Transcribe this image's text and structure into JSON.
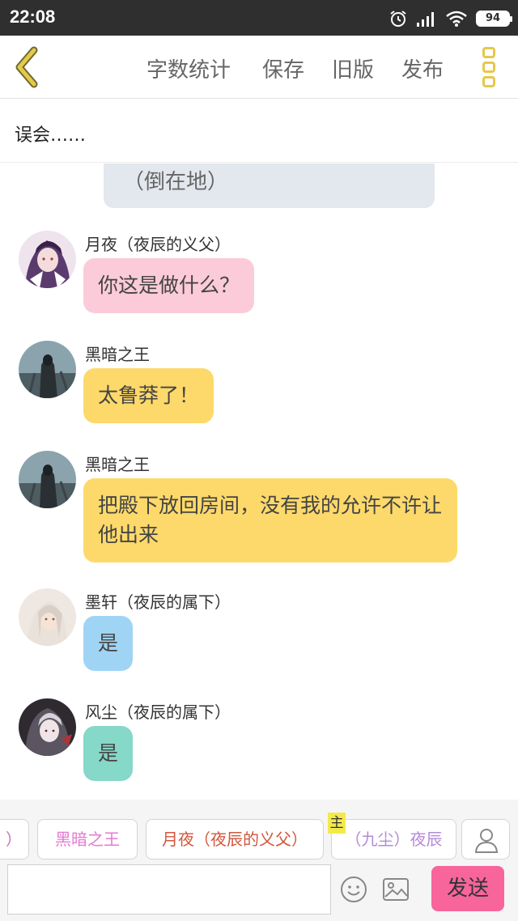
{
  "status_bar": {
    "time": "22:08",
    "battery": "94",
    "icons": [
      "alarm-icon",
      "signal-icon",
      "wifi-icon",
      "battery-icon"
    ]
  },
  "toolbar": {
    "back_icon": "chevron-left-icon",
    "word_count": "字数统计",
    "save": "保存",
    "old_version": "旧版",
    "publish": "发布",
    "menu_icon": "more-vertical-icon"
  },
  "chapter": {
    "title": "误会……"
  },
  "messages": [
    {
      "type": "narration",
      "text": "（倒在地）"
    },
    {
      "type": "chat",
      "sender": "月夜（夜辰的义父）",
      "text": "你这是做什么？",
      "bubble_color": "#fccbd9"
    },
    {
      "type": "chat",
      "sender": "黑暗之王",
      "text": "太鲁莽了！",
      "bubble_color": "#fcd96a"
    },
    {
      "type": "chat",
      "sender": "黑暗之王",
      "text": "把殿下放回房间，没有我的允许不许让他出来",
      "bubble_color": "#fcd96a"
    },
    {
      "type": "chat",
      "sender": "墨轩（夜辰的属下）",
      "text": "是",
      "bubble_color": "#9fd4f5"
    },
    {
      "type": "chat",
      "sender": "风尘（夜辰的属下）",
      "text": "是",
      "bubble_color": "#86d8c9"
    }
  ],
  "character_bar": {
    "chips": [
      {
        "label": "）",
        "color": "#d06bc0"
      },
      {
        "label": "黑暗之王",
        "color": "#e47ad0"
      },
      {
        "label": "月夜（夜辰的义父）",
        "color": "#d2573e"
      },
      {
        "label": "（九尘）夜辰",
        "color": "#b58ad8"
      }
    ],
    "host_badge": "主",
    "person_icon": "person-icon"
  },
  "input_bar": {
    "value": "",
    "placeholder": "",
    "emoji_icon": "smiley-icon",
    "image_icon": "image-icon",
    "send": "发送",
    "send_color": "#f7659b"
  }
}
